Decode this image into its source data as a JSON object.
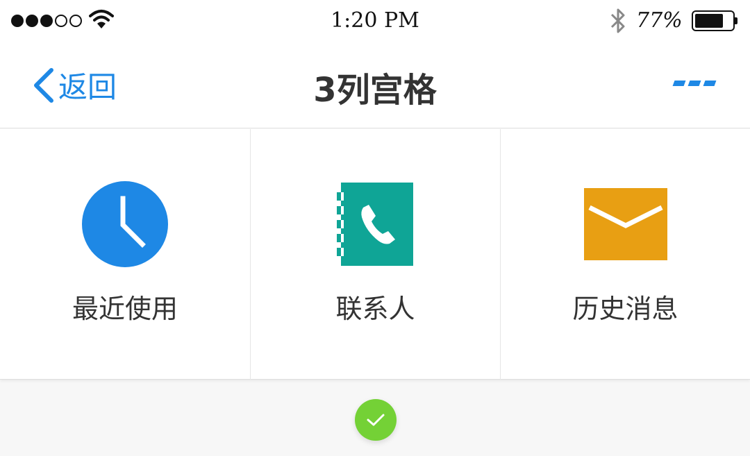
{
  "status_bar": {
    "signal_dots_filled": 3,
    "signal_dots_empty": 2,
    "time": "1:20 PM",
    "battery_percent": "77%",
    "battery_level": 0.77
  },
  "nav": {
    "back_label": "返回",
    "title": "3列宫格",
    "more_icon": "more-dots-icon"
  },
  "grid": {
    "items": [
      {
        "label": "最近使用",
        "icon": "clock-icon",
        "color": "#1e88e5"
      },
      {
        "label": "联系人",
        "icon": "contacts-book-icon",
        "color": "#0fa596"
      },
      {
        "label": "历史消息",
        "icon": "envelope-icon",
        "color": "#e89f13"
      }
    ]
  },
  "colors": {
    "accent": "#1e88e5",
    "check": "#74d136"
  }
}
